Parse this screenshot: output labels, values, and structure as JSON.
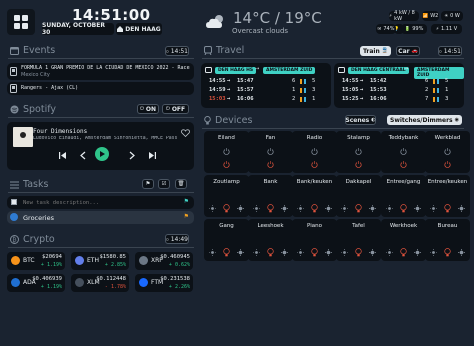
{
  "header": {
    "time": "14:51:00",
    "date": "SUNDAY, OCTOBER 30",
    "city": "DEN HAAG",
    "temp": "14°C / 19°C",
    "weather_desc": "Overcast clouds",
    "status": [
      {
        "icon": "power-icon",
        "text": "4 kW / 8 kW"
      },
      {
        "icon": "wifi-icon",
        "text": "W2"
      },
      {
        "icon": "sun-icon",
        "text": "0 W"
      },
      {
        "icon": "lightbulb-icon",
        "text": "5"
      },
      {
        "icon": "mail-icon",
        "text": "74%"
      },
      {
        "icon": "battery-icon",
        "text": "99%"
      },
      {
        "icon": "volt-icon",
        "text": "1.11 V"
      }
    ]
  },
  "events": {
    "title": "Events",
    "time_badge": "14:51",
    "items": [
      {
        "title": "FORMULA 1 GRAN PREMIO DE LA CIUDAD DE MÉXICO 2022 - Race",
        "sub": "Mexico City"
      },
      {
        "title": "Rangers - Ajax (CL)",
        "sub": ""
      }
    ]
  },
  "spotify": {
    "title": "Spotify",
    "on_label": "ON",
    "off_label": "OFF",
    "track": "Four Dimensions",
    "artist": "Ludovico Einaudi, Amsterdam Sinfonietta, MMCE Pass"
  },
  "tasks": {
    "title": "Tasks",
    "input_placeholder": "New task description...",
    "items": [
      {
        "label": "Groceries"
      }
    ]
  },
  "crypto": {
    "title": "Crypto",
    "time_badge": "14:49",
    "coins": [
      {
        "sym": "BTC",
        "price": "$20694",
        "change": "+ 1.19%",
        "color": "#f7931a",
        "up": true
      },
      {
        "sym": "ETH",
        "price": "$1580.85",
        "change": "+ 2.85%",
        "color": "#627eea",
        "up": true
      },
      {
        "sym": "XRP",
        "price": "$0.460945",
        "change": "+ 0.62%",
        "color": "#6b7785",
        "up": true
      },
      {
        "sym": "ADA",
        "price": "$0.406939",
        "change": "+ 1.19%",
        "color": "#1f6fd1",
        "up": true
      },
      {
        "sym": "XLM",
        "price": "$0.112448",
        "change": "- 1.78%",
        "color": "#454f5c",
        "up": false
      },
      {
        "sym": "FTM",
        "price": "$0.231538",
        "change": "+ 2.26%",
        "color": "#1969ff",
        "up": true
      }
    ]
  },
  "travel": {
    "title": "Travel",
    "train_label": "Train",
    "car_label": "Car",
    "time_badge": "14:51",
    "routes": [
      {
        "from": "DEN HAAG HS",
        "to": "AMSTERDAM ZUID",
        "rows": [
          {
            "dep": "14:55",
            "arr": "15:47",
            "t1": "6",
            "t2": "5"
          },
          {
            "dep": "14:59",
            "arr": "15:57",
            "t1": "1",
            "t2": "3"
          },
          {
            "dep": "15:03",
            "arr": "16:06",
            "t1": "2",
            "t2": "1"
          }
        ]
      },
      {
        "from": "DEN HAAG CENTRAAL",
        "to": "AMSTERDAM ZUID",
        "rows": [
          {
            "dep": "14:55",
            "arr": "15:42",
            "t1": "6",
            "t2": "5"
          },
          {
            "dep": "15:05",
            "arr": "15:53",
            "t1": "2",
            "t2": "1"
          },
          {
            "dep": "15:25",
            "arr": "16:06",
            "t1": "7",
            "t2": "3"
          }
        ]
      }
    ]
  },
  "devices": {
    "title": "Devices",
    "scenes_label": "Scenes",
    "switches_label": "Switches/Dimmers",
    "items": [
      "Eiland",
      "Fan",
      "Radio",
      "Stalamp",
      "Teddybank",
      "Werkblad",
      "Zoutlamp",
      "Bank",
      "Bank/keuken",
      "Dakkapel",
      "Entree/gang",
      "Entree/keuken",
      "Gang",
      "Leeshoek",
      "Piano",
      "Tafel",
      "Werkhoek",
      "Bureau"
    ]
  },
  "colors": {
    "accent": "#3fd1c4",
    "bg": "#1a2330",
    "card": "#0c1117",
    "red": "#e0533d",
    "green": "#2fc48a"
  }
}
